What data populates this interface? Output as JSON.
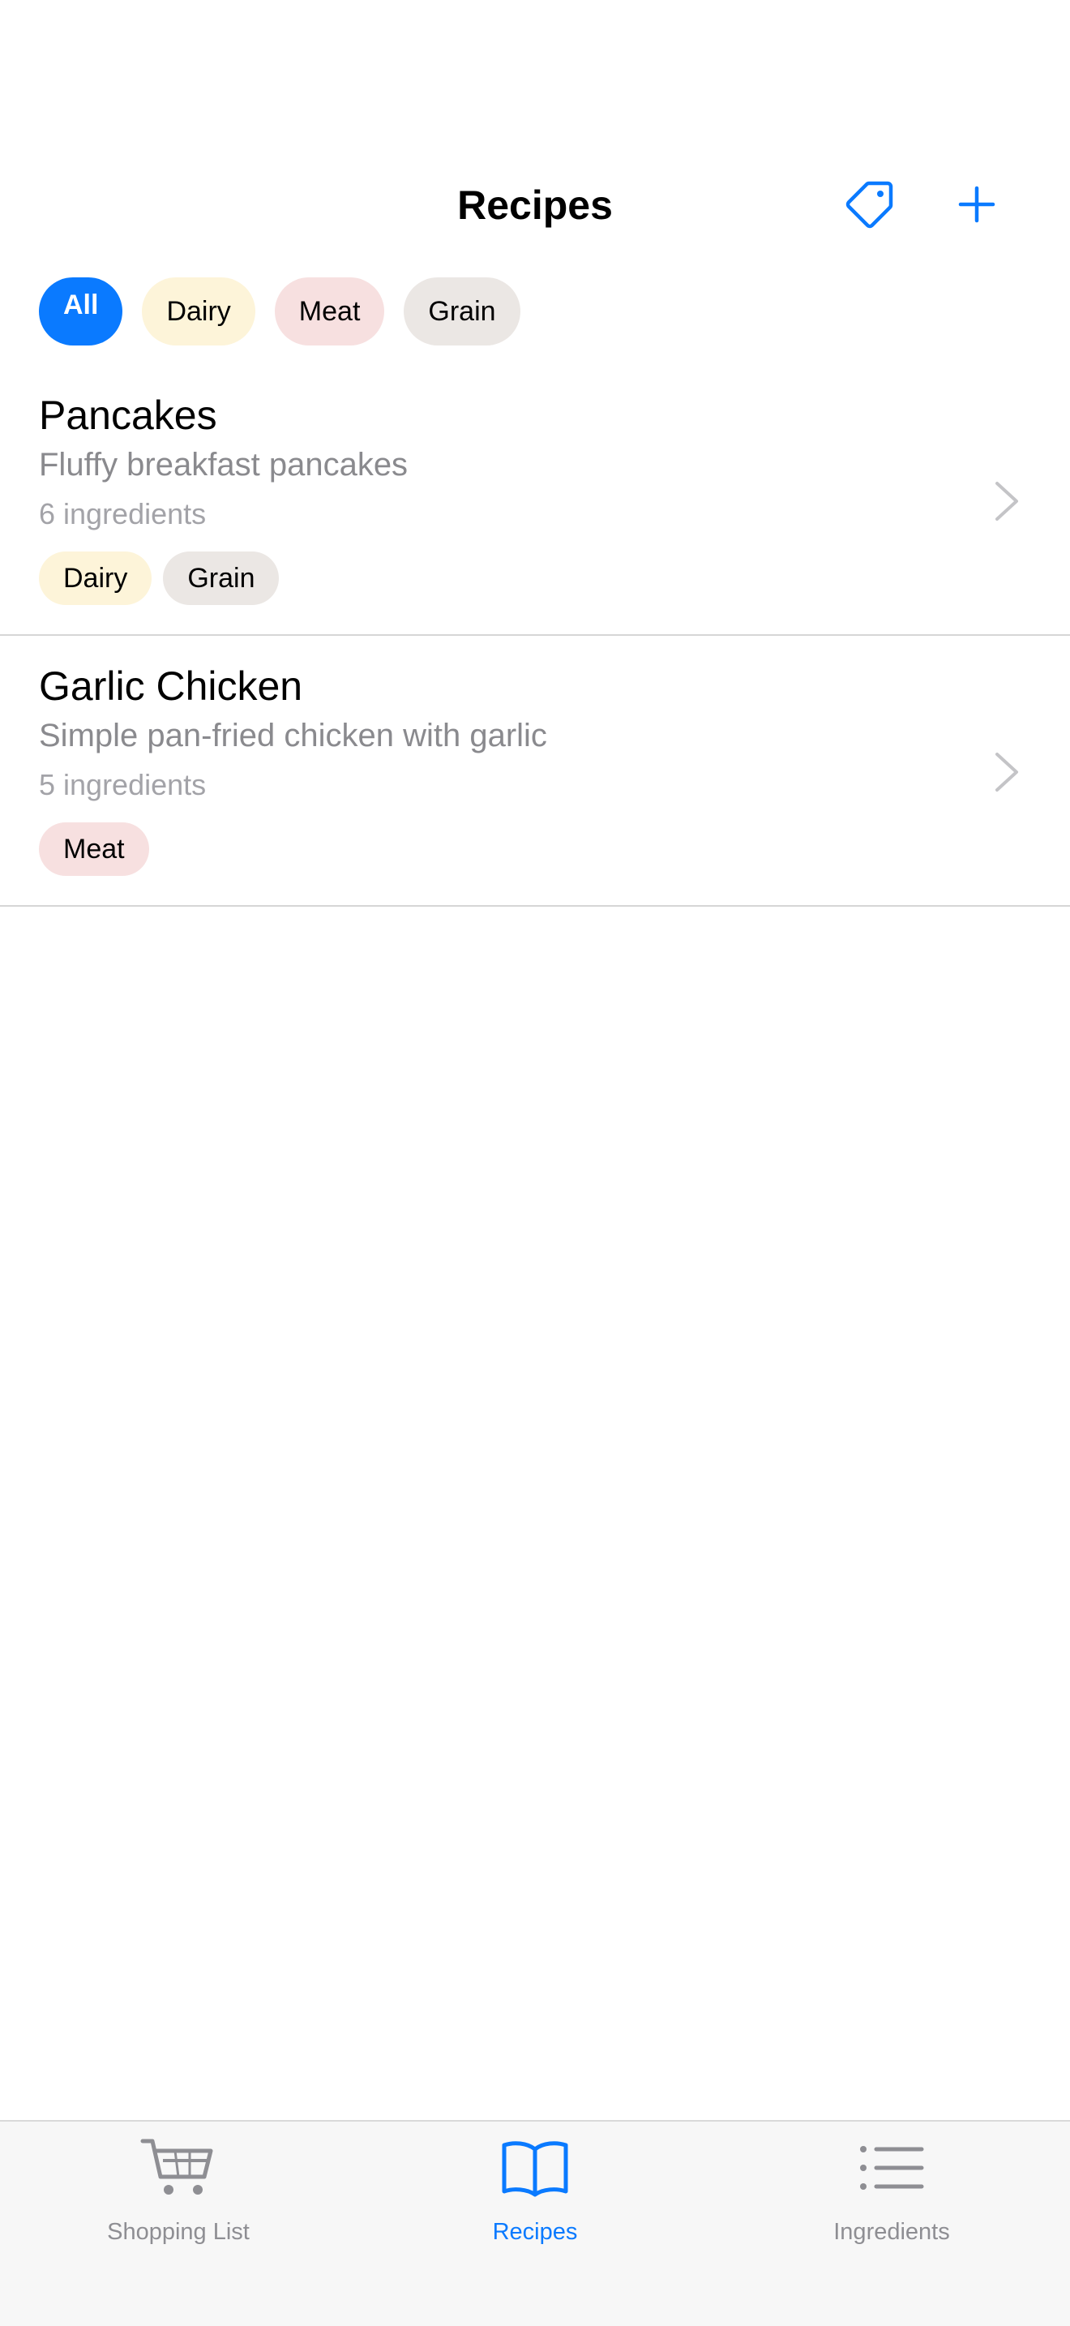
{
  "colors": {
    "accent": "#0a7aff",
    "chip_selected_bg": "#0a7aff",
    "dairy_bg": "#fdf4d9",
    "meat_bg": "#f7e0e0",
    "grain_bg": "#ebe7e4",
    "tab_inactive": "#8e8e93"
  },
  "header": {
    "title": "Recipes",
    "tags_icon": "tag-icon",
    "add_icon": "plus-icon"
  },
  "filters": [
    {
      "label": "All",
      "selected": true,
      "color": "#0a7aff"
    },
    {
      "label": "Dairy",
      "selected": false,
      "color": "#fdf4d9"
    },
    {
      "label": "Meat",
      "selected": false,
      "color": "#f7e0e0"
    },
    {
      "label": "Grain",
      "selected": false,
      "color": "#ebe7e4"
    }
  ],
  "recipes": [
    {
      "title": "Pancakes",
      "description": "Fluffy breakfast pancakes",
      "count": "6 ingredients",
      "tags": [
        {
          "label": "Dairy",
          "color": "#fdf4d9"
        },
        {
          "label": "Grain",
          "color": "#ebe7e4"
        }
      ]
    },
    {
      "title": "Garlic Chicken",
      "description": "Simple pan-fried chicken with garlic",
      "count": "5 ingredients",
      "tags": [
        {
          "label": "Meat",
          "color": "#f7e0e0"
        }
      ]
    }
  ],
  "tabbar": {
    "tabs": [
      {
        "label": "Shopping List",
        "icon": "cart-icon",
        "active": false
      },
      {
        "label": "Recipes",
        "icon": "book-icon",
        "active": true
      },
      {
        "label": "Ingredients",
        "icon": "list-icon",
        "active": false
      }
    ]
  }
}
